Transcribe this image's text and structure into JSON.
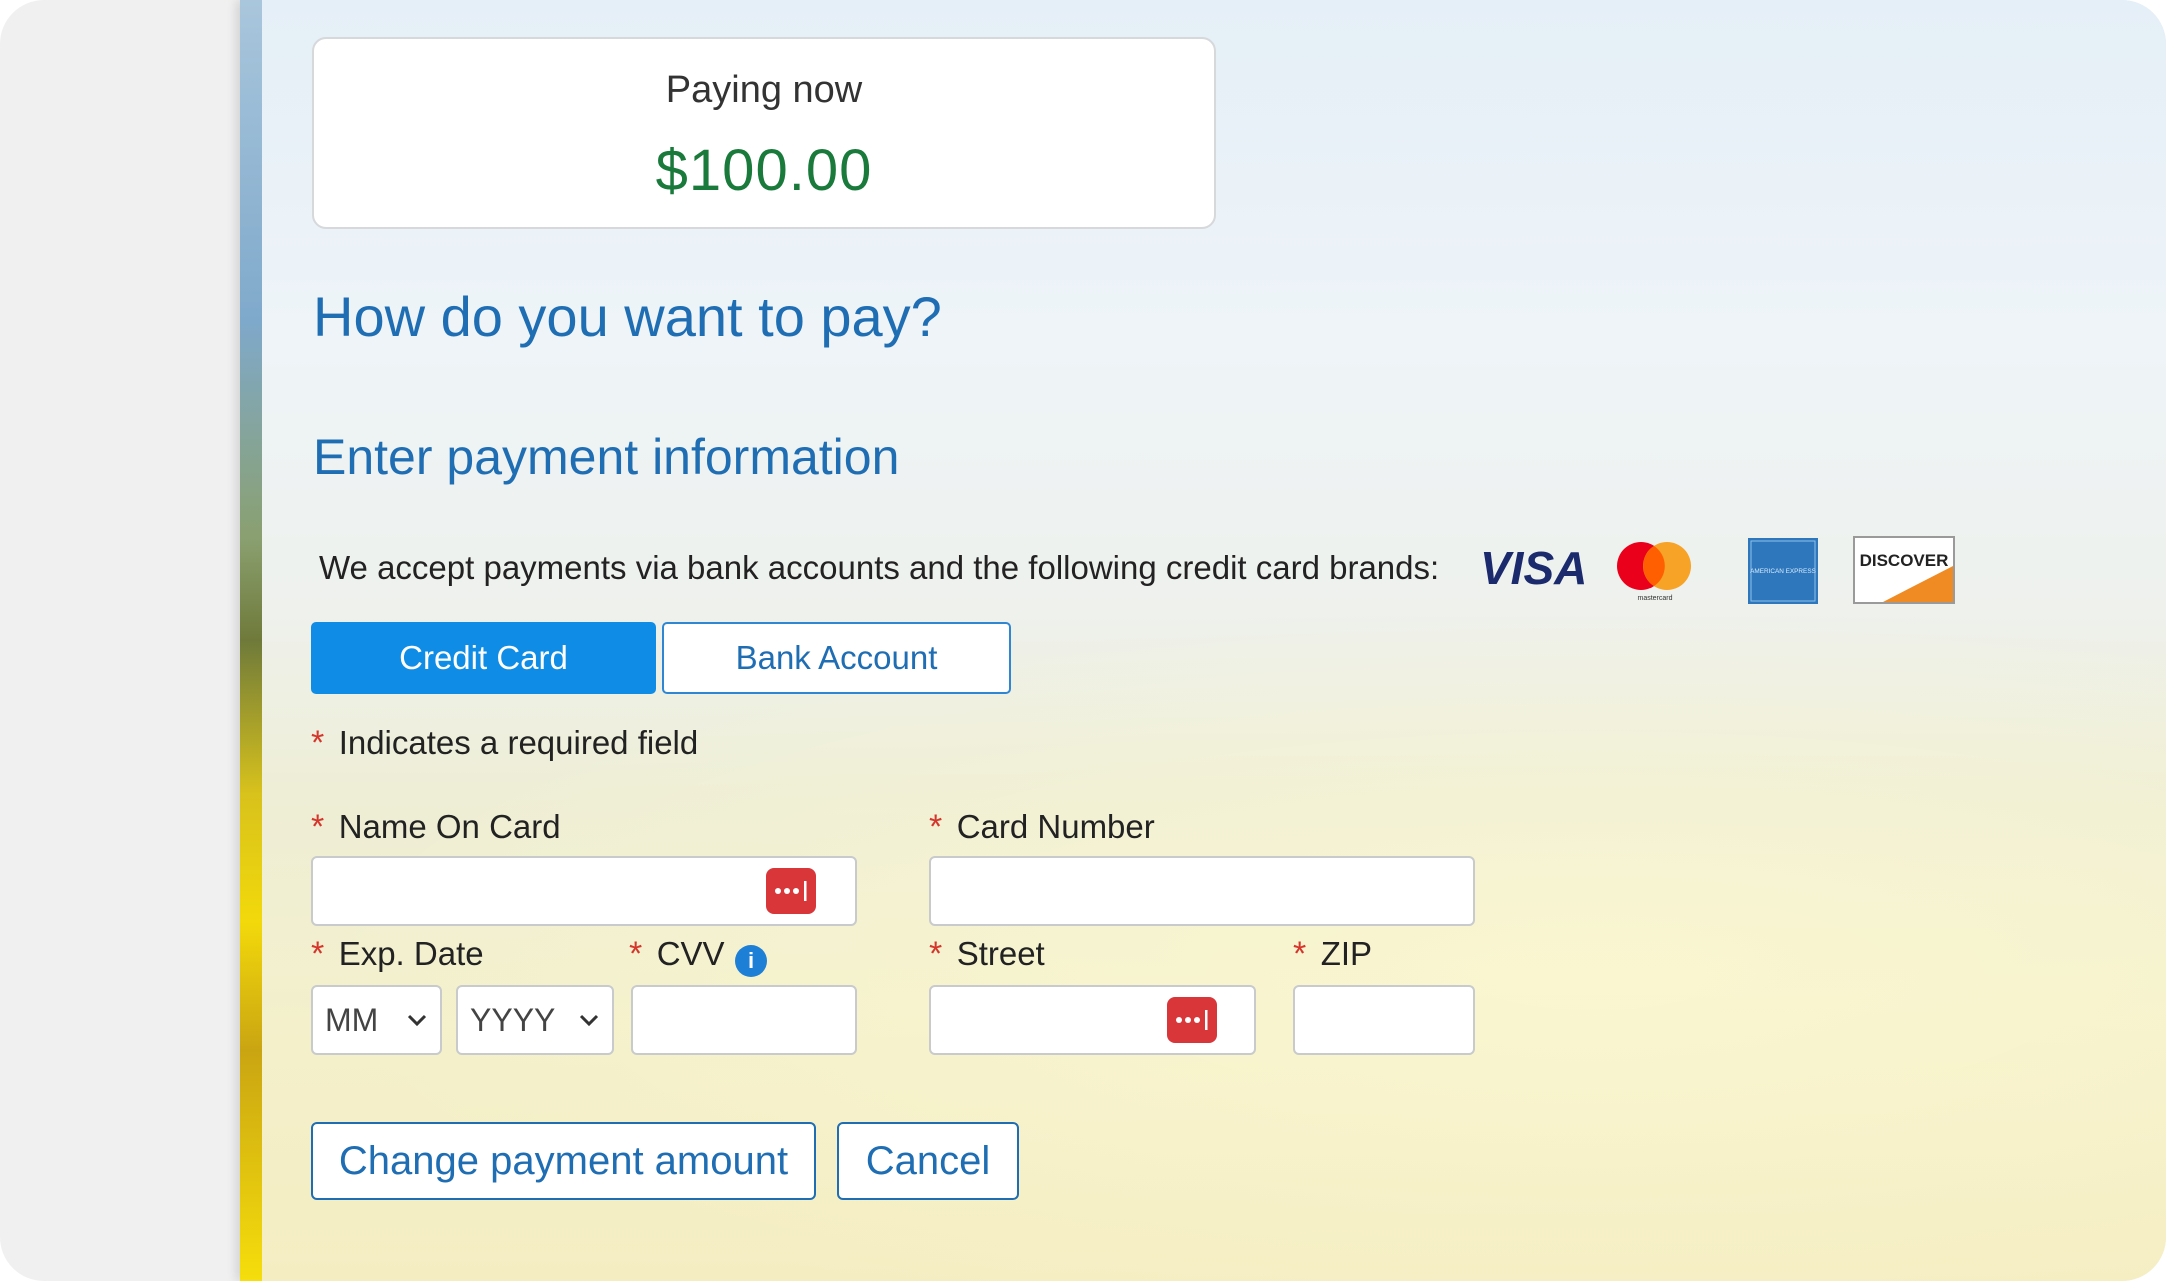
{
  "summary": {
    "paying_label": "Paying now",
    "amount": "$100.00"
  },
  "headings": {
    "question": "How do you want to pay?",
    "section": "Enter payment information"
  },
  "accept": {
    "text": "We accept payments via bank accounts and the following credit card brands:",
    "brands": [
      "VISA",
      "mastercard",
      "AMERICAN EXPRESS",
      "DISCOVER"
    ]
  },
  "tabs": {
    "credit_card": "Credit Card",
    "bank_account": "Bank Account",
    "selected": "Credit Card"
  },
  "required": {
    "mark": "*",
    "note": "Indicates a required field"
  },
  "fields": {
    "name_on_card": {
      "label": "Name On Card",
      "value": ""
    },
    "card_number": {
      "label": "Card Number",
      "value": ""
    },
    "exp_date": {
      "label": "Exp. Date",
      "month": "MM",
      "year": "YYYY"
    },
    "cvv": {
      "label": "CVV",
      "value": "",
      "info_icon": "info-icon"
    },
    "street": {
      "label": "Street",
      "value": ""
    },
    "zip": {
      "label": "ZIP",
      "value": ""
    }
  },
  "buttons": {
    "change_amount": "Change payment amount",
    "cancel": "Cancel"
  },
  "colors": {
    "accent": "#0f8de6",
    "heading": "#1f6eb4",
    "amount": "#1a7a3b",
    "required": "#d5352b",
    "password_icon": "#d9363a"
  }
}
